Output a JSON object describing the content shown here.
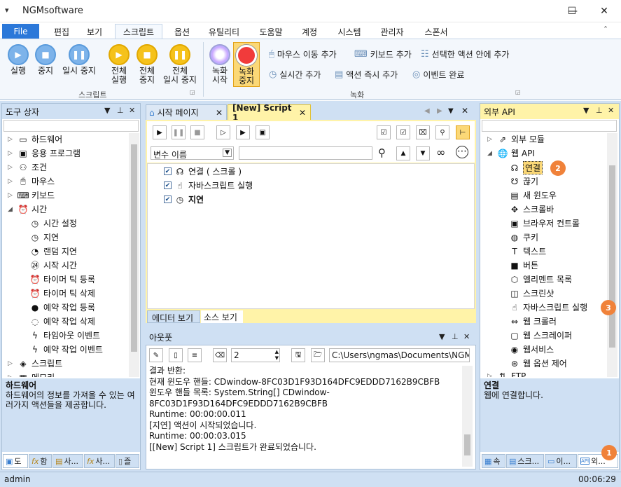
{
  "window": {
    "title": "NGMsoftware",
    "menu_icon": "▾",
    "minimize": "—",
    "maximize": "☐",
    "close": "✕"
  },
  "menu_tabs": [
    "File",
    "편집",
    "보기",
    "스크립트",
    "옵션",
    "유틸리티",
    "도움말",
    "계정",
    "시스템",
    "관리자",
    "스폰서"
  ],
  "collapse_ribbon": "ˆ",
  "ribbon": {
    "script_group": {
      "label": "스크립트",
      "buttons": [
        {
          "label": "실행",
          "icon": "play-icon"
        },
        {
          "label": "중지",
          "icon": "stop-icon"
        },
        {
          "label": "일시 중지",
          "icon": "pause-icon"
        },
        {
          "label": "전체\n실행",
          "icon": "play-all-icon"
        },
        {
          "label": "전체\n중지",
          "icon": "stop-all-icon"
        },
        {
          "label": "전체\n일시 중지",
          "icon": "pause-all-icon"
        }
      ]
    },
    "record_group": {
      "label": "녹화",
      "buttons": [
        {
          "label": "녹화\n시작",
          "icon": "record-start-icon"
        },
        {
          "label": "녹화\n중지",
          "icon": "record-stop-icon"
        }
      ],
      "small": [
        {
          "label": "마우스 이동 추가",
          "icon": "mouse-icon"
        },
        {
          "label": "키보드 추가",
          "icon": "keyboard-icon"
        },
        {
          "label": "선택한 액션 안에 추가",
          "icon": "hierarchy-icon"
        },
        {
          "label": "실시간 추가",
          "icon": "clock-icon"
        },
        {
          "label": "액션 즉시 추가",
          "icon": "window-icon"
        },
        {
          "label": "이벤트 완료",
          "icon": "event-icon"
        }
      ]
    }
  },
  "toolbox": {
    "title": "도구 상자",
    "items": [
      {
        "label": "하드웨어",
        "icon": "laptop-icon",
        "level": 0,
        "expand": "▷"
      },
      {
        "label": "응용 프로그램",
        "icon": "terminal-icon",
        "level": 0,
        "expand": "▷"
      },
      {
        "label": "조건",
        "icon": "condition-icon",
        "level": 0,
        "expand": "▷"
      },
      {
        "label": "마우스",
        "icon": "mouse-icon",
        "level": 0,
        "expand": "▷"
      },
      {
        "label": "키보드",
        "icon": "keyboard-icon",
        "level": 0,
        "expand": "▷"
      },
      {
        "label": "시간",
        "icon": "alarm-icon",
        "level": 0,
        "expand": "◢"
      },
      {
        "label": "시간 설정",
        "icon": "clock-icon",
        "level": 1
      },
      {
        "label": "지연",
        "icon": "clock-icon",
        "level": 1
      },
      {
        "label": "랜덤 지연",
        "icon": "random-delay-icon",
        "level": 1
      },
      {
        "label": "시작 시간",
        "icon": "24h-icon",
        "level": 1
      },
      {
        "label": "타이머 틱 등록",
        "icon": "alarm-icon",
        "level": 1
      },
      {
        "label": "타이머 틱 삭제",
        "icon": "alarm-off-icon",
        "level": 1
      },
      {
        "label": "예약 작업 등록",
        "icon": "schedule-add-icon",
        "level": 1
      },
      {
        "label": "예약 작업 삭제",
        "icon": "schedule-remove-icon",
        "level": 1
      },
      {
        "label": "타임아웃 이벤트",
        "icon": "lightning-icon",
        "level": 1
      },
      {
        "label": "예약 작업 이벤트",
        "icon": "lightning-icon",
        "level": 1
      },
      {
        "label": "스크립트",
        "icon": "script-icon",
        "level": 0,
        "expand": "▷"
      },
      {
        "label": "메모리",
        "icon": "memory-icon",
        "level": 0,
        "expand": "▷"
      }
    ],
    "desc_title": "하드웨어",
    "desc_text": "하드웨어의 정보를 가져올 수 있는 여러가지 액션들을 제공합니다.",
    "bottom_tabs": [
      "도",
      "함",
      "사...",
      "사...",
      "즐"
    ]
  },
  "editor": {
    "tabs": [
      {
        "label": "시작 페이지",
        "close": "✕"
      },
      {
        "label": "[New] Script 1",
        "close": "✕"
      }
    ],
    "variable_select": "변수 이름",
    "actions": [
      {
        "label": "연결 ( 스크롤 )",
        "bold": false
      },
      {
        "label": "자바스크립트 실행",
        "bold": false
      },
      {
        "label": "지연",
        "bold": true
      }
    ],
    "view_tabs": [
      "에디터 보기",
      "소스 보기"
    ]
  },
  "output": {
    "title": "아웃풋",
    "spinner_value": "2",
    "path": "C:\\Users\\ngmas\\Documents\\NGM6\\",
    "lines": [
      "결과 반환:",
      "현재 윈도우 핸들: CDwindow-8FC03D1F93D164DFC9EDDD7162B9CBFB",
      "윈도우 핸들 목록: System.String[] CDwindow-",
      "8FC03D1F93D164DFC9EDDD7162B9CBFB",
      "Runtime: 00:00:00.011",
      "[지연] 액션이 시작되었습니다.",
      "Runtime: 00:00:03.015",
      "[[New] Script 1] 스크립트가 완료되었습니다."
    ]
  },
  "external_api": {
    "title": "외부 API",
    "items": [
      {
        "label": "외부 모듈",
        "icon": "external-link-icon",
        "level": 0,
        "expand": "▷"
      },
      {
        "label": "웹 API",
        "icon": "globe-icon",
        "level": 0,
        "expand": "◢"
      },
      {
        "label": "연결",
        "icon": "connect-icon",
        "level": 1,
        "selected": true
      },
      {
        "label": "끊기",
        "icon": "disconnect-icon",
        "level": 1
      },
      {
        "label": "새 윈도우",
        "icon": "new-window-icon",
        "level": 1
      },
      {
        "label": "스크롤바",
        "icon": "move-icon",
        "level": 1
      },
      {
        "label": "브라우저 컨트롤",
        "icon": "browser-control-icon",
        "level": 1
      },
      {
        "label": "쿠키",
        "icon": "cookie-icon",
        "level": 1
      },
      {
        "label": "텍스트",
        "icon": "text-icon",
        "level": 1
      },
      {
        "label": "버튼",
        "icon": "button-icon",
        "level": 1
      },
      {
        "label": "엘리멘트 목록",
        "icon": "cube-icon",
        "level": 1
      },
      {
        "label": "스크린샷",
        "icon": "camera-icon",
        "level": 1
      },
      {
        "label": "자바스크립트 실행",
        "icon": "javascript-icon",
        "level": 1
      },
      {
        "label": "웹 크롤러",
        "icon": "crawler-icon",
        "level": 1
      },
      {
        "label": "웹 스크레이퍼",
        "icon": "scraper-icon",
        "level": 1
      },
      {
        "label": "웹서비스",
        "icon": "webservice-icon",
        "level": 1
      },
      {
        "label": "웹 옵션 제어",
        "icon": "web-options-icon",
        "level": 1
      },
      {
        "label": "FTP",
        "icon": "ftp-icon",
        "level": 0,
        "expand": "▷"
      }
    ],
    "desc_title": "연결",
    "desc_text": "웹에 연결합니다.",
    "bottom_tabs": [
      "속",
      "스크...",
      "이...",
      "외..."
    ],
    "badges": [
      "1",
      "2",
      "3"
    ]
  },
  "status": {
    "user": "admin",
    "time": "00:06:29"
  }
}
